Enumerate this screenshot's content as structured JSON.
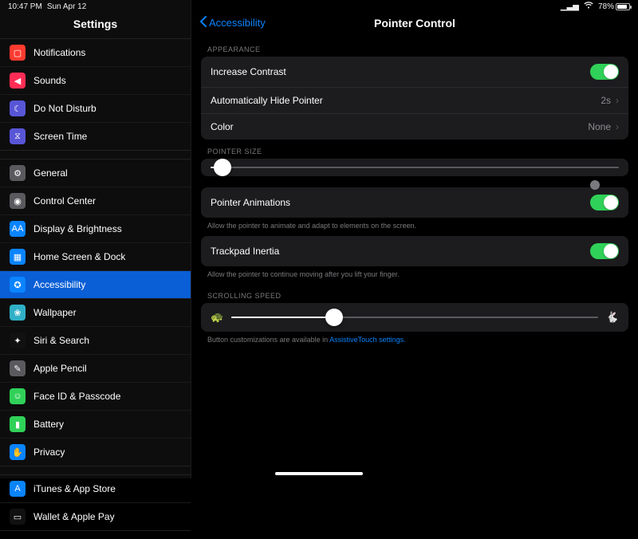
{
  "status": {
    "time": "10:47 PM",
    "date": "Sun Apr 12",
    "battery_pct": "78%"
  },
  "sidebar": {
    "title": "Settings",
    "groups": [
      {
        "items": [
          {
            "icon": "i-red",
            "glyph": "▢",
            "label": "Notifications"
          },
          {
            "icon": "i-pink",
            "glyph": "◀︎",
            "label": "Sounds"
          },
          {
            "icon": "i-purple",
            "glyph": "☾",
            "label": "Do Not Disturb"
          },
          {
            "icon": "i-purple",
            "glyph": "⧖",
            "label": "Screen Time"
          }
        ]
      },
      {
        "items": [
          {
            "icon": "i-gray",
            "glyph": "⚙",
            "label": "General"
          },
          {
            "icon": "i-gray",
            "glyph": "◉",
            "label": "Control Center"
          },
          {
            "icon": "i-blue",
            "glyph": "AA",
            "label": "Display & Brightness"
          },
          {
            "icon": "i-blue",
            "glyph": "▦",
            "label": "Home Screen & Dock"
          },
          {
            "icon": "i-blue",
            "glyph": "✪",
            "label": "Accessibility",
            "selected": true
          },
          {
            "icon": "i-cyan",
            "glyph": "❀",
            "label": "Wallpaper"
          },
          {
            "icon": "i-black",
            "glyph": "✦",
            "label": "Siri & Search"
          },
          {
            "icon": "i-gray",
            "glyph": "✎",
            "label": "Apple Pencil"
          },
          {
            "icon": "i-green",
            "glyph": "☺",
            "label": "Face ID & Passcode"
          },
          {
            "icon": "i-green",
            "glyph": "▮",
            "label": "Battery"
          },
          {
            "icon": "i-blue",
            "glyph": "✋",
            "label": "Privacy"
          }
        ]
      },
      {
        "items": [
          {
            "icon": "i-blue",
            "glyph": "A",
            "label": "iTunes & App Store"
          },
          {
            "icon": "i-black",
            "glyph": "▭",
            "label": "Wallet & Apple Pay"
          }
        ]
      }
    ]
  },
  "detail": {
    "back": "Accessibility",
    "title": "Pointer Control",
    "appearance_header": "APPEARANCE",
    "rows": {
      "increase_contrast": "Increase Contrast",
      "auto_hide": "Automatically Hide Pointer",
      "auto_hide_value": "2s",
      "color": "Color",
      "color_value": "None"
    },
    "pointer_size_header": "POINTER SIZE",
    "pointer_size_pct": 3,
    "animations": {
      "label": "Pointer Animations",
      "footer": "Allow the pointer to animate and adapt to elements on the screen."
    },
    "inertia": {
      "label": "Trackpad Inertia",
      "footer": "Allow the pointer to continue moving after you lift your finger."
    },
    "scroll_header": "SCROLLING SPEED",
    "scroll_pct": 28,
    "buttons_note_prefix": "Button customizations are available in ",
    "buttons_note_link": "AssistiveTouch settings."
  }
}
